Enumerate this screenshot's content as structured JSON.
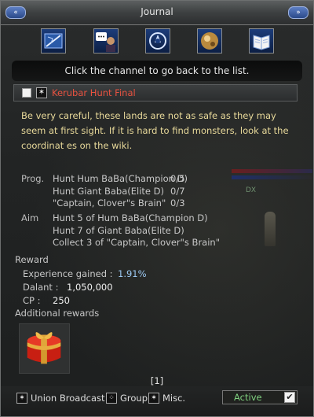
{
  "window": {
    "title": "Journal",
    "left_button": "«",
    "right_button": "»"
  },
  "channels": [
    {
      "icon": "compass-map-icon"
    },
    {
      "icon": "npc-chat-icon"
    },
    {
      "icon": "emblem-icon"
    },
    {
      "icon": "orb-icon"
    },
    {
      "icon": "book-icon"
    }
  ],
  "channel_hint": "Click the channel to go back to the list.",
  "quest": {
    "title": "Kerubar Hunt Final",
    "description": "Be very careful, these lands are not as safe as they may seem at first sight. If it is hard to find monsters, look at the coordinat es on the wiki.",
    "prog_label": "Prog.",
    "progress": [
      {
        "name": "Hunt Hum BaBa(Champion D)",
        "count": "0/5"
      },
      {
        "name": "Hunt Giant Baba(Elite D)",
        "count": "0/7"
      },
      {
        "name": "\"Captain, Clover\"s Brain\"",
        "count": "0/3"
      }
    ],
    "aim_label": "Aim",
    "aims": [
      "Hunt 5 of Hum BaBa(Champion D)",
      "Hunt 7 of Giant Baba(Elite D)",
      "Collect 3 of \"Captain, Clover\"s Brain\""
    ]
  },
  "reward": {
    "label": "Reward",
    "experience_label": "Experience gained :",
    "experience_value": "1.91%",
    "dalant_label": "Dalant :",
    "dalant_value": "1,050,000",
    "cp_label": "CP :",
    "cp_value": "250",
    "additional_label": "Additional rewards",
    "item_icon": "gift-box-icon"
  },
  "pager": "[1]",
  "filters": {
    "union_broadcast": "Union Broadcast",
    "group": "Group",
    "misc": "Misc."
  },
  "status_select": {
    "value": "Active"
  },
  "background": {
    "badge": "DX"
  },
  "colors": {
    "quest_title": "#e85240",
    "description": "#e8d99a",
    "experience": "#9cc9f2",
    "active": "#7fd17f"
  }
}
